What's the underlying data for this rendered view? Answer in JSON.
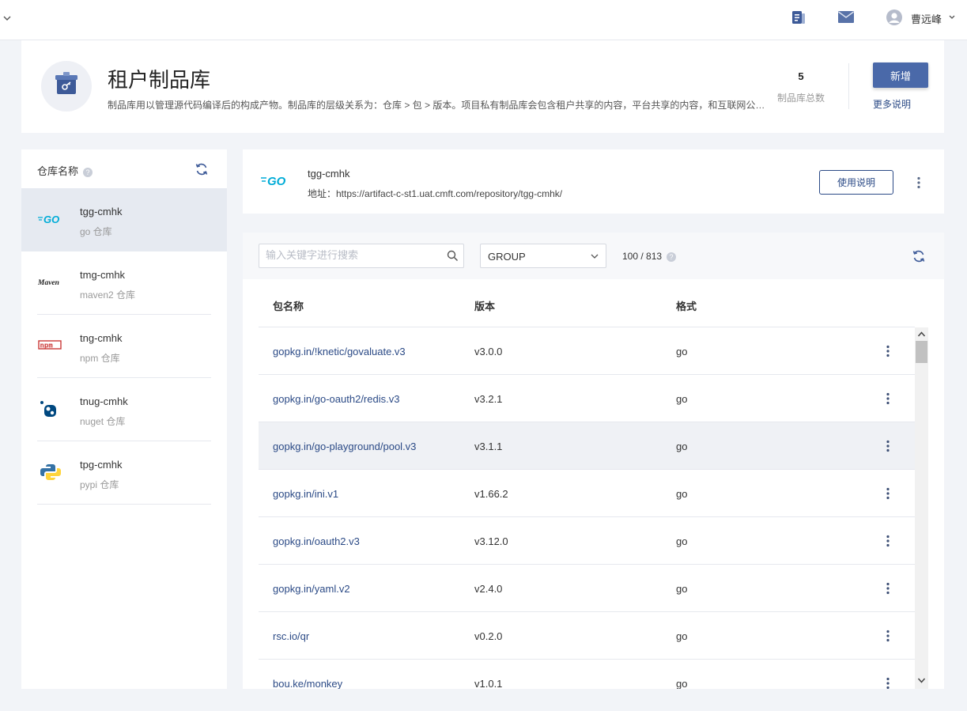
{
  "topbar": {
    "username": "曹远峰"
  },
  "header": {
    "title": "租户制品库",
    "description": "制品库用以管理源代码编译后的构成产物。制品库的层级关系为：仓库 > 包 > 版本。项目私有制品库会包含租户共享的内容，平台共享的内容，和互联网公共仓库的内容。",
    "stat_value": "5",
    "stat_label": "制品库总数",
    "add_label": "新增",
    "more_label": "更多说明"
  },
  "repos": {
    "title": "仓库名称",
    "items": [
      {
        "name": "tgg-cmhk",
        "type": "go 仓库"
      },
      {
        "name": "tmg-cmhk",
        "type": "maven2 仓库"
      },
      {
        "name": "tng-cmhk",
        "type": "npm 仓库"
      },
      {
        "name": "tnug-cmhk",
        "type": "nuget 仓库"
      },
      {
        "name": "tpg-cmhk",
        "type": "pypi 仓库"
      }
    ],
    "logo_text": {
      "go": "GO",
      "maven": "Maven",
      "npm": "npm"
    }
  },
  "repo_card": {
    "name": "tgg-cmhk",
    "address": "地址：https://artifact-c-st1.uat.cmft.com/repository/tgg-cmhk/",
    "usage_label": "使用说明"
  },
  "packages": {
    "search_placeholder": "输入关键字进行搜索",
    "group_value": "GROUP",
    "count": "100 / 813",
    "columns": {
      "name": "包名称",
      "version": "版本",
      "format": "格式"
    },
    "rows": [
      {
        "name": "gopkg.in/!knetic/govaluate.v3",
        "version": "v3.0.0",
        "format": "go"
      },
      {
        "name": "gopkg.in/go-oauth2/redis.v3",
        "version": "v3.2.1",
        "format": "go"
      },
      {
        "name": "gopkg.in/go-playground/pool.v3",
        "version": "v3.1.1",
        "format": "go"
      },
      {
        "name": "gopkg.in/ini.v1",
        "version": "v1.66.2",
        "format": "go"
      },
      {
        "name": "gopkg.in/oauth2.v3",
        "version": "v3.12.0",
        "format": "go"
      },
      {
        "name": "gopkg.in/yaml.v2",
        "version": "v2.4.0",
        "format": "go"
      },
      {
        "name": "rsc.io/qr",
        "version": "v0.2.0",
        "format": "go"
      },
      {
        "name": "bou.ke/monkey",
        "version": "v1.0.1",
        "format": "go"
      }
    ]
  },
  "colors": {
    "primary": "#4a69a9",
    "link": "#2b4a86",
    "go_cyan": "#00acd7",
    "npm_red": "#cb3837"
  }
}
